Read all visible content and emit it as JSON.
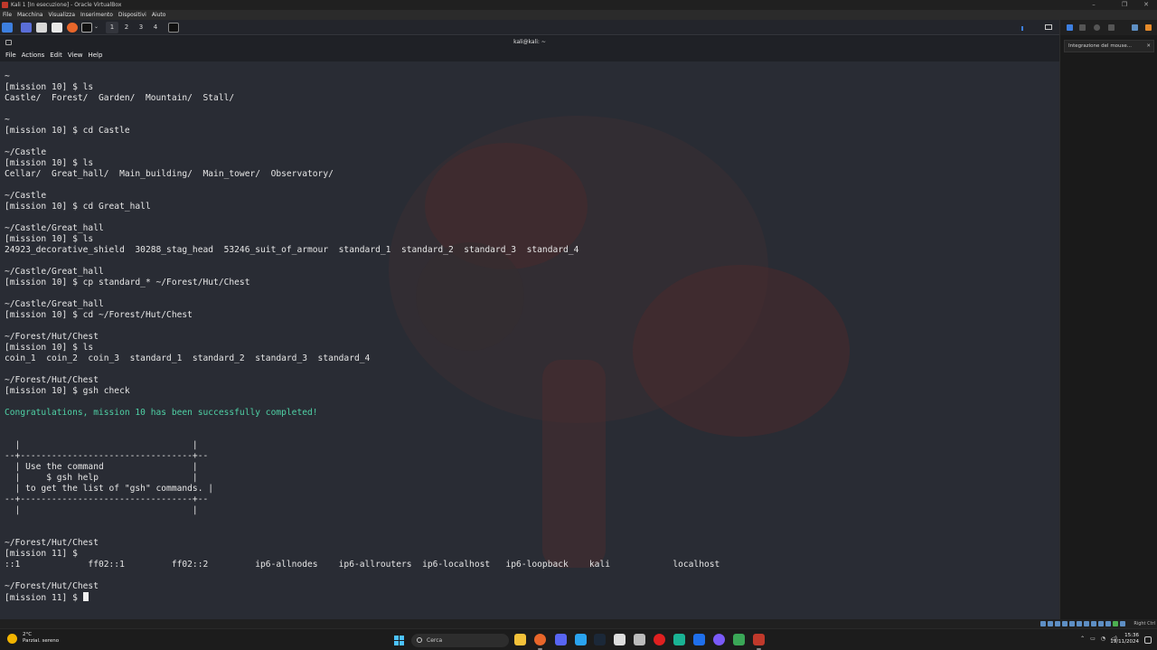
{
  "vbox": {
    "window_title": "Kali 1 [In esecuzione] - Oracle VirtualBox",
    "menu": [
      "File",
      "Macchina",
      "Visualizza",
      "Inserimento",
      "Dispositivi",
      "Aiuto"
    ],
    "side_notice": "Integrazione del mouse...",
    "host_key": "Right Ctrl"
  },
  "guest_panel": {
    "workspaces": [
      "1",
      "2",
      "3",
      "4"
    ],
    "active_workspace": "1"
  },
  "terminal": {
    "title": "kali@kali: ~",
    "menu": [
      "File",
      "Actions",
      "Edit",
      "View",
      "Help"
    ],
    "lines": [
      "~",
      "[mission 10] $ ls",
      "Castle/  Forest/  Garden/  Mountain/  Stall/",
      "",
      "~",
      "[mission 10] $ cd Castle",
      "",
      "~/Castle",
      "[mission 10] $ ls",
      "Cellar/  Great_hall/  Main_building/  Main_tower/  Observatory/",
      "",
      "~/Castle",
      "[mission 10] $ cd Great_hall",
      "",
      "~/Castle/Great_hall",
      "[mission 10] $ ls",
      "24923_decorative_shield  30288_stag_head  53246_suit_of_armour  standard_1  standard_2  standard_3  standard_4",
      "",
      "~/Castle/Great_hall",
      "[mission 10] $ cp standard_* ~/Forest/Hut/Chest",
      "",
      "~/Castle/Great_hall",
      "[mission 10] $ cd ~/Forest/Hut/Chest",
      "",
      "~/Forest/Hut/Chest",
      "[mission 10] $ ls",
      "coin_1  coin_2  coin_3  standard_1  standard_2  standard_3  standard_4",
      "",
      "~/Forest/Hut/Chest",
      "[mission 10] $ gsh check",
      "",
      "Congratulations, mission 10 has been successfully completed!",
      "",
      "",
      "  |                                 |",
      "--+---------------------------------+--",
      "  | Use the command                 |",
      "  |     $ gsh help                  |",
      "  | to get the list of \"gsh\" commands. |",
      "--+---------------------------------+--",
      "  |                                 |",
      "",
      "",
      "~/Forest/Hut/Chest",
      "[mission 11] $",
      "::1             ff02::1         ff02::2         ip6-allnodes    ip6-allrouters  ip6-localhost   ip6-loopback    kali            localhost",
      "",
      "~/Forest/Hut/Chest",
      "[mission 11] $ "
    ],
    "green_line_index": 31
  },
  "taskbar": {
    "weather_temp": "2°C",
    "weather_desc": "Parzial. sereno",
    "search_placeholder": "Cerca",
    "time": "15:36",
    "date": "19/11/2024"
  },
  "colors": {
    "terminal_bg": "#292c34",
    "terminal_fg": "#e6e6e6",
    "success_green": "#4fd1a5",
    "taskbar_bg": "#1c1c1c"
  }
}
